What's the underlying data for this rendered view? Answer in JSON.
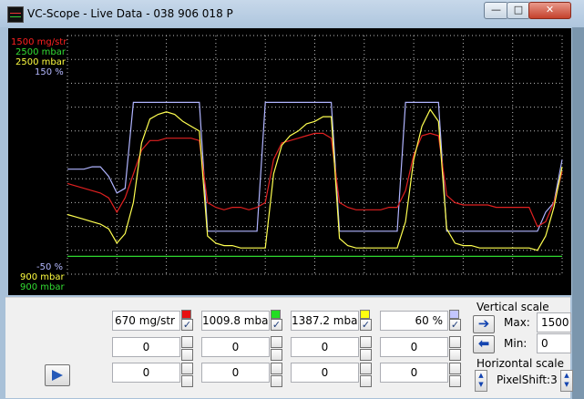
{
  "window": {
    "title": "VC-Scope  -  Live Data  -  038 906 018 P",
    "min_symbol": "—",
    "max_symbol": "□",
    "close_symbol": "✕"
  },
  "scope": {
    "labels_top": [
      {
        "text": "1500 mg/str",
        "color": "#ff2020"
      },
      {
        "text": "2500 mbar",
        "color": "#33dd33"
      },
      {
        "text": "2500 mbar",
        "color": "#ffff40"
      },
      {
        "text": "150 %",
        "color": "#b4b8ff"
      }
    ],
    "labels_bottom": [
      {
        "text": "-50 %",
        "color": "#b4b8ff"
      },
      {
        "text": "900 mbar",
        "color": "#ffff40"
      },
      {
        "text": "900 mbar",
        "color": "#33dd33"
      }
    ],
    "grid": true,
    "series": [
      {
        "color": "#b0b4ff",
        "y": [
          0.56,
          0.56,
          0.56,
          0.55,
          0.55,
          0.59,
          0.66,
          0.64,
          0.28,
          0.28,
          0.28,
          0.28,
          0.28,
          0.28,
          0.28,
          0.28,
          0.28,
          0.82,
          0.82,
          0.82,
          0.82,
          0.82,
          0.82,
          0.82,
          0.28,
          0.28,
          0.28,
          0.28,
          0.28,
          0.28,
          0.28,
          0.28,
          0.28,
          0.82,
          0.82,
          0.82,
          0.82,
          0.82,
          0.82,
          0.82,
          0.82,
          0.28,
          0.28,
          0.28,
          0.28,
          0.28,
          0.82,
          0.82,
          0.82,
          0.82,
          0.82,
          0.82,
          0.82,
          0.82,
          0.82,
          0.82,
          0.82,
          0.82,
          0.74,
          0.7,
          0.52
        ]
      },
      {
        "color": "#e02020",
        "y": [
          0.62,
          0.63,
          0.64,
          0.65,
          0.66,
          0.68,
          0.74,
          0.68,
          0.58,
          0.48,
          0.44,
          0.44,
          0.43,
          0.43,
          0.43,
          0.43,
          0.44,
          0.7,
          0.72,
          0.73,
          0.72,
          0.72,
          0.73,
          0.72,
          0.7,
          0.52,
          0.45,
          0.44,
          0.43,
          0.42,
          0.41,
          0.41,
          0.43,
          0.7,
          0.72,
          0.73,
          0.73,
          0.73,
          0.73,
          0.72,
          0.72,
          0.65,
          0.5,
          0.42,
          0.41,
          0.42,
          0.67,
          0.7,
          0.71,
          0.71,
          0.71,
          0.71,
          0.72,
          0.72,
          0.72,
          0.72,
          0.72,
          0.8,
          0.78,
          0.7,
          0.57
        ]
      },
      {
        "color": "#ffff50",
        "y": [
          0.75,
          0.76,
          0.77,
          0.78,
          0.79,
          0.81,
          0.87,
          0.83,
          0.7,
          0.45,
          0.35,
          0.33,
          0.32,
          0.33,
          0.36,
          0.38,
          0.4,
          0.84,
          0.87,
          0.88,
          0.88,
          0.89,
          0.89,
          0.89,
          0.89,
          0.58,
          0.46,
          0.42,
          0.4,
          0.37,
          0.36,
          0.34,
          0.34,
          0.85,
          0.88,
          0.89,
          0.89,
          0.89,
          0.89,
          0.89,
          0.89,
          0.78,
          0.52,
          0.38,
          0.31,
          0.36,
          0.81,
          0.87,
          0.88,
          0.88,
          0.89,
          0.89,
          0.89,
          0.89,
          0.89,
          0.89,
          0.89,
          0.9,
          0.84,
          0.72,
          0.55
        ]
      },
      {
        "color": "#2ed82e",
        "y": [
          0.925,
          0.925,
          0.925,
          0.925,
          0.925,
          0.925,
          0.925,
          0.925,
          0.925,
          0.925,
          0.925,
          0.925,
          0.925,
          0.925,
          0.925,
          0.925,
          0.925,
          0.925,
          0.925,
          0.925,
          0.925,
          0.925,
          0.925,
          0.925,
          0.925,
          0.925,
          0.925,
          0.925,
          0.925,
          0.925,
          0.925,
          0.925,
          0.925,
          0.925,
          0.925,
          0.925,
          0.925,
          0.925,
          0.925,
          0.925,
          0.925,
          0.925,
          0.925,
          0.925,
          0.925,
          0.925,
          0.925,
          0.925,
          0.925,
          0.925,
          0.925,
          0.925,
          0.925,
          0.925,
          0.925,
          0.925,
          0.925,
          0.925,
          0.925,
          0.925,
          0.925
        ]
      }
    ]
  },
  "channels": [
    {
      "value": "670 mg/str",
      "color": "#e81010",
      "checked": true
    },
    {
      "value": "1009.8 mbar",
      "color": "#22dd22",
      "checked": true
    },
    {
      "value": "1387.2 mbar",
      "color": "#ffff10",
      "checked": true
    },
    {
      "value": "60 %",
      "color": "#c3c6ff",
      "checked": true
    }
  ],
  "extra_rows": [
    [
      "0",
      "0",
      "0",
      "0"
    ],
    [
      "0",
      "0",
      "0",
      "0"
    ]
  ],
  "vertical_scale": {
    "title": "Vertical scale",
    "max_label": "Max:",
    "max_value": "1500",
    "min_label": "Min:",
    "min_value": "0"
  },
  "horizontal_scale": {
    "title": "Horizontal scale",
    "value": "PixelShift:3"
  },
  "check_mark": "✓"
}
